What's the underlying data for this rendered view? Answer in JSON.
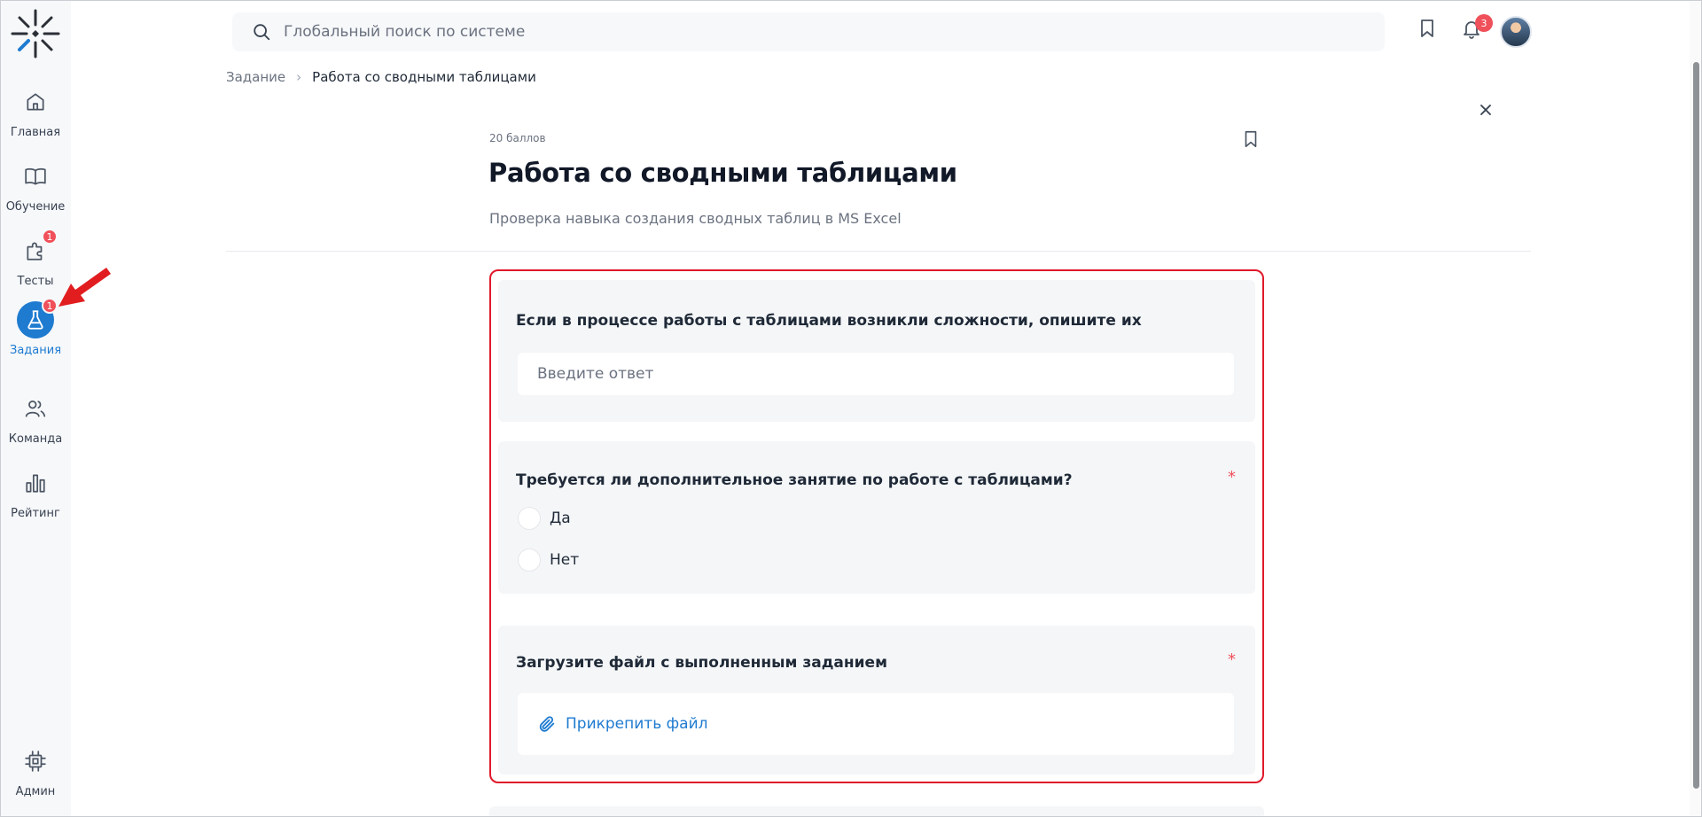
{
  "sidebar": {
    "items": [
      {
        "label": "Главная",
        "icon": "home-icon",
        "badge": ""
      },
      {
        "label": "Обучение",
        "icon": "book-icon",
        "badge": ""
      },
      {
        "label": "Тесты",
        "icon": "puzzle-icon",
        "badge": "1"
      },
      {
        "label": "Задания",
        "icon": "flask-icon",
        "badge": "1",
        "active": true
      },
      {
        "label": "Команда",
        "icon": "users-icon",
        "badge": ""
      },
      {
        "label": "Рейтинг",
        "icon": "bar-chart-icon",
        "badge": ""
      },
      {
        "label": "Админ",
        "icon": "chip-icon",
        "badge": ""
      }
    ]
  },
  "header": {
    "search_placeholder": "Глобальный поиск по системе",
    "notifications_count": "3"
  },
  "breadcrumb": {
    "parent": "Задание",
    "current": "Работа со сводными таблицами"
  },
  "task": {
    "points": "20 баллов",
    "title": "Работа со сводными таблицами",
    "subtitle": "Проверка навыка создания сводных таблиц в MS Excel"
  },
  "form": {
    "q1": {
      "title": "Если в процессе работы с таблицами возникли сложности, опишите их",
      "placeholder": "Введите ответ"
    },
    "q2": {
      "title": "Требуется ли дополнительное занятие по работе с таблицами?",
      "required": "*",
      "options": [
        "Да",
        "Нет"
      ]
    },
    "q3": {
      "title": "Загрузите файл с выполненным заданием",
      "required": "*",
      "attach_label": "Прикрепить файл"
    }
  },
  "colors": {
    "accent": "#1e7bd0",
    "badge": "#f0505a",
    "highlight_border": "#e1192b"
  }
}
